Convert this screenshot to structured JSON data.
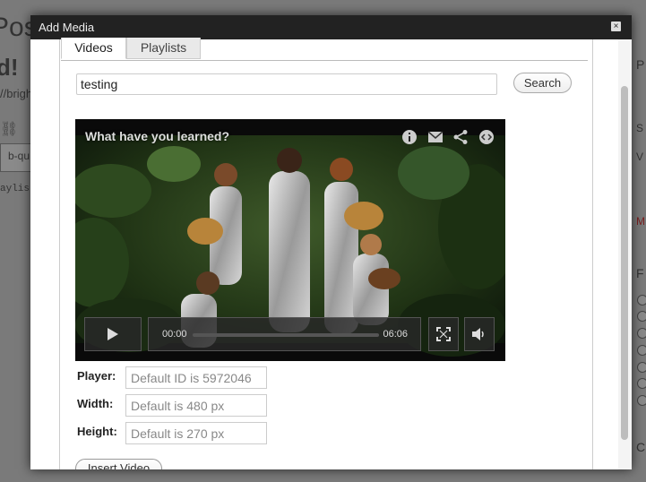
{
  "background": {
    "title_fragment": "Pos",
    "heading_fragment": "d!",
    "url_fragment": "//brigh",
    "input_fragment": "b-qu",
    "code_fragment": "aylis",
    "right_fragments": [
      "P",
      "S",
      "V",
      "M",
      "F",
      "C"
    ]
  },
  "modal": {
    "title": "Add Media",
    "close_symbol": "×"
  },
  "tabs": [
    {
      "label": "Videos",
      "active": true
    },
    {
      "label": "Playlists",
      "active": false
    }
  ],
  "search": {
    "value": "testing",
    "button_label": "Search"
  },
  "player": {
    "video_title": "What have you learned?",
    "current_time": "00:00",
    "duration": "06:06",
    "progress": 0,
    "icons": [
      "info-icon",
      "email-icon",
      "share-icon",
      "embed-icon"
    ]
  },
  "form": {
    "player_label": "Player:",
    "player_placeholder": "Default ID is 5972046",
    "width_label": "Width:",
    "width_placeholder": "Default is 480 px",
    "height_label": "Height:",
    "height_placeholder": "Default is 270 px",
    "insert_label": "Insert Video"
  },
  "colors": {
    "header_bg": "#222222",
    "overlay": "#7a7a7a",
    "player_bg": "#0c0f0a"
  }
}
